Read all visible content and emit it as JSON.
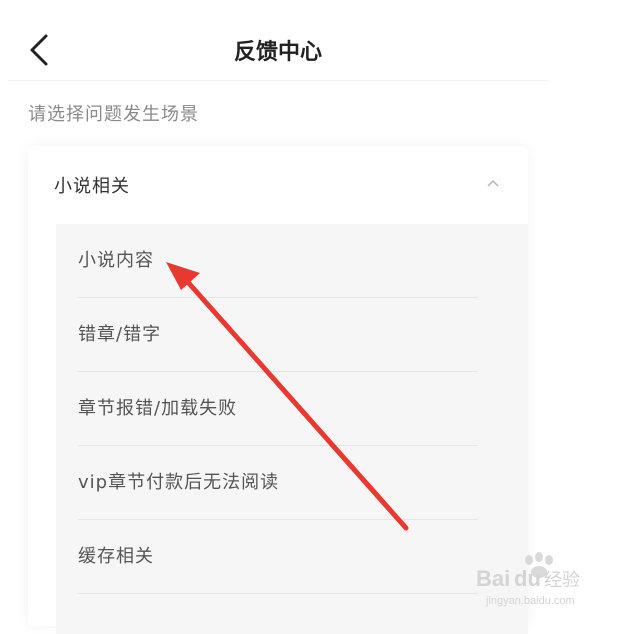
{
  "header": {
    "title": "反馈中心",
    "back_icon": "chevron-left-icon"
  },
  "prompt": "请选择问题发生场景",
  "card": {
    "title": "小说相关",
    "expanded": true,
    "chevron_icon": "chevron-up-icon",
    "items": [
      {
        "label": "小说内容"
      },
      {
        "label": "错章/错字"
      },
      {
        "label": "章节报错/加载失败"
      },
      {
        "label": "vip章节付款后无法阅读"
      },
      {
        "label": "缓存相关"
      }
    ]
  },
  "annotation": {
    "color": "#e8382f",
    "points_to": "小说内容"
  },
  "watermark": {
    "text": "Baidu经验",
    "url_text": "jingyan.baidu.com"
  },
  "colors": {
    "title": "#222222",
    "muted": "#8a8a8a",
    "sublist_bg": "#f6f6f6"
  }
}
